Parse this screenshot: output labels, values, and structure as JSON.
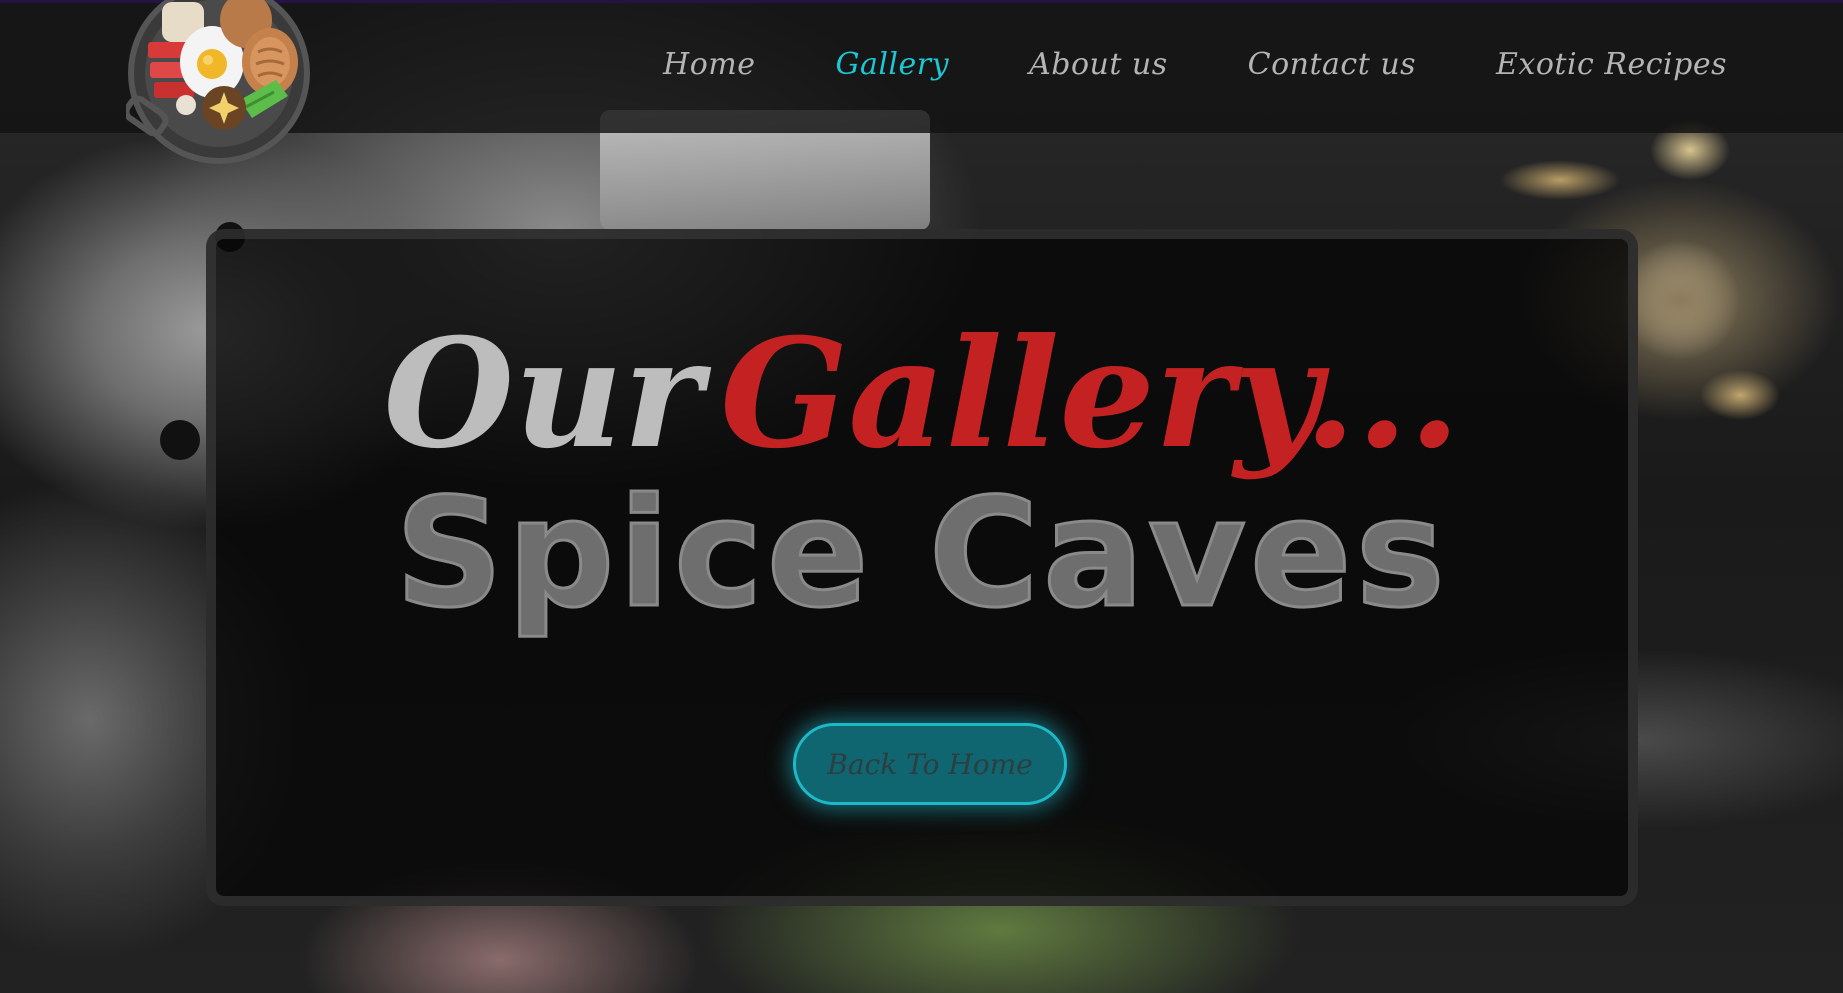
{
  "nav": {
    "items": [
      {
        "label": "Home",
        "active": false
      },
      {
        "label": "Gallery",
        "active": true
      },
      {
        "label": "About us",
        "active": false
      },
      {
        "label": "Contact us",
        "active": false
      },
      {
        "label": "Exotic Recipes",
        "active": false
      }
    ]
  },
  "logo": {
    "icon": "breakfast-plate-icon"
  },
  "hero": {
    "title_word1": "Our",
    "title_word2": "Gallery...",
    "brand": "Spice Caves",
    "button_label": "Back To Home"
  },
  "colors": {
    "accent": "#1cc7d4",
    "title_accent": "#c42222",
    "nav_text": "#b4b4b4",
    "topbar_border": "#241345"
  }
}
